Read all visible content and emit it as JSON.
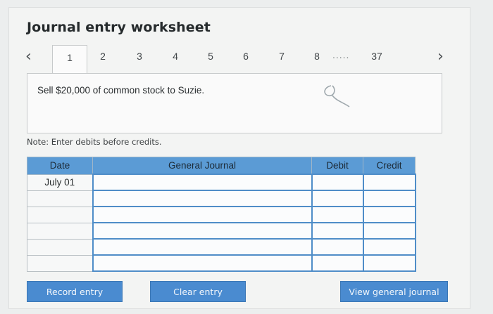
{
  "title": "Journal entry worksheet",
  "tabs": [
    "1",
    "2",
    "3",
    "4",
    "5",
    "6",
    "7",
    "8"
  ],
  "tabs_ellipsis": ".....",
  "last_tab": "37",
  "active_tab_index": 0,
  "description": "Sell $20,000 of common stock to Suzie.",
  "note": "Note: Enter debits before credits.",
  "table": {
    "headers": {
      "date": "Date",
      "general_journal": "General Journal",
      "debit": "Debit",
      "credit": "Credit"
    },
    "rows": [
      {
        "date": "July 01",
        "account": "",
        "debit": "",
        "credit": ""
      },
      {
        "date": "",
        "account": "",
        "debit": "",
        "credit": ""
      },
      {
        "date": "",
        "account": "",
        "debit": "",
        "credit": ""
      },
      {
        "date": "",
        "account": "",
        "debit": "",
        "credit": ""
      },
      {
        "date": "",
        "account": "",
        "debit": "",
        "credit": ""
      },
      {
        "date": "",
        "account": "",
        "debit": "",
        "credit": ""
      }
    ]
  },
  "buttons": {
    "record": "Record entry",
    "clear": "Clear entry",
    "view": "View general journal"
  },
  "icons": {
    "prev": "chevron-left-icon",
    "next": "chevron-right-icon"
  },
  "colors": {
    "header_blue": "#5b9bd5",
    "button_blue": "#4a8bd0"
  }
}
